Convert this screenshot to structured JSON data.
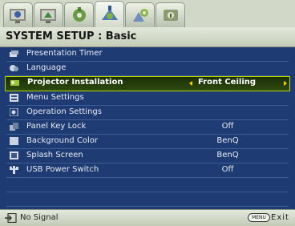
{
  "tabs": [
    {
      "icon": "display-picture-icon",
      "active": false
    },
    {
      "icon": "advanced-picture-icon",
      "active": false
    },
    {
      "icon": "display-settings-icon",
      "active": false
    },
    {
      "icon": "system-setup-basic-icon",
      "active": true
    },
    {
      "icon": "system-setup-advanced-icon",
      "active": false
    },
    {
      "icon": "information-icon",
      "active": false
    }
  ],
  "header": {
    "title": "SYSTEM SETUP : Basic"
  },
  "menu": {
    "items": [
      {
        "label": "Presentation Timer",
        "value": "",
        "icon": "timer-icon"
      },
      {
        "label": "Language",
        "value": "",
        "icon": "language-icon"
      },
      {
        "label": "Projector Installation",
        "value": "Front Ceiling",
        "icon": "projector-icon",
        "selected": true
      },
      {
        "label": "Menu Settings",
        "value": "",
        "icon": "menu-settings-icon"
      },
      {
        "label": "Operation Settings",
        "value": "",
        "icon": "operation-settings-icon"
      },
      {
        "label": "Panel Key Lock",
        "value": "Off",
        "icon": "key-lock-icon"
      },
      {
        "label": "Background Color",
        "value": "BenQ",
        "icon": "background-color-icon"
      },
      {
        "label": "Splash Screen",
        "value": "BenQ",
        "icon": "splash-screen-icon"
      },
      {
        "label": "USB Power Switch",
        "value": "Off",
        "icon": "usb-icon"
      }
    ]
  },
  "footer": {
    "status": "No Signal",
    "menu_key": "MENU",
    "exit_label": "Exit",
    "status_icon": "input-source-icon"
  },
  "colors": {
    "background": "#1e3b73",
    "selection_border": "#b7d400",
    "selection_fill": "#2c4a10",
    "arrow": "#ffd400",
    "chrome": "#d2d8c8"
  }
}
